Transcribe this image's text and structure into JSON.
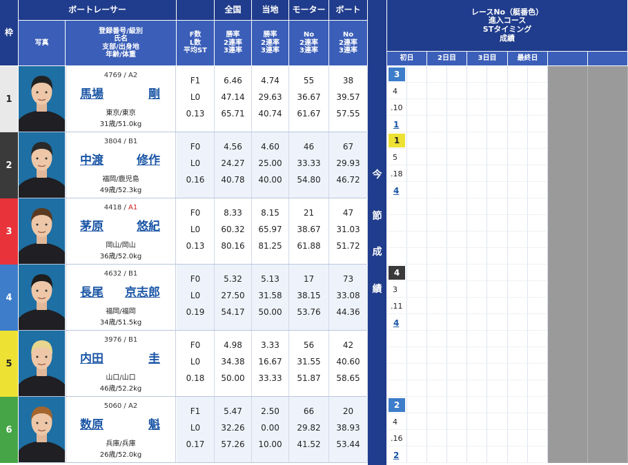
{
  "header": {
    "waku": "枠",
    "boat_racer": "ボートレーサー",
    "zenkoku": "全国",
    "touchi": "当地",
    "motor": "モーター",
    "boat": "ボート",
    "photo": "写真",
    "racer_sub": [
      "登録番号/級別",
      "氏名",
      "支部/出身地",
      "年齢/体重"
    ],
    "f_sub": [
      "F数",
      "L数",
      "平均ST"
    ],
    "rate_sub": [
      "勝率",
      "2連率",
      "3連率"
    ],
    "no_sub": [
      "No",
      "2連率",
      "3連率"
    ],
    "results_title": [
      "レースNo（艇番色）",
      "進入コース",
      "STタイミング",
      "成績"
    ],
    "days": [
      "初日",
      "2日目",
      "3日目",
      "最終日"
    ],
    "konsetsu": [
      "今",
      "節",
      "成",
      "績"
    ]
  },
  "colors": {
    "header_dark": "#203c8c",
    "header_light": "#3b5eb8",
    "waku": [
      "#ffffff",
      "#3a3a3a",
      "#e8333a",
      "#3d7dca",
      "#ede134",
      "#46a546"
    ],
    "waku_text": [
      "#222222",
      "#ffffff",
      "#ffffff",
      "#ffffff",
      "#222222",
      "#ffffff"
    ]
  },
  "racers": [
    {
      "waku": "1",
      "reg": "4769 / A2",
      "class_highlight": false,
      "name_a": "馬場",
      "name_b": "剛",
      "branch": "東京/東京",
      "age": "31歳/51.0kg",
      "f": "F1",
      "l": "L0",
      "st": "0.13",
      "zen": [
        "6.46",
        "47.14",
        "65.71"
      ],
      "tou": [
        "4.74",
        "29.63",
        "40.74"
      ],
      "motor": [
        "55",
        "36.67",
        "61.67"
      ],
      "boat": [
        "38",
        "39.57",
        "57.55"
      ],
      "results": [
        {
          "race": "3",
          "course": "4",
          "st": ".10",
          "rank": "1"
        }
      ]
    },
    {
      "waku": "2",
      "reg": "3804 / B1",
      "class_highlight": false,
      "name_a": "中渡",
      "name_b": "修作",
      "branch": "福岡/鹿児島",
      "age": "49歳/52.3kg",
      "f": "F0",
      "l": "L0",
      "st": "0.16",
      "zen": [
        "4.56",
        "24.27",
        "40.78"
      ],
      "tou": [
        "4.60",
        "25.00",
        "40.00"
      ],
      "motor": [
        "46",
        "33.33",
        "54.80"
      ],
      "boat": [
        "67",
        "29.93",
        "46.72"
      ],
      "results": [
        {
          "race": "1",
          "course": "5",
          "st": ".18",
          "rank": "4"
        }
      ]
    },
    {
      "waku": "3",
      "reg_num": "4418 / ",
      "reg_cls": "A1",
      "class_highlight": true,
      "name_a": "茅原",
      "name_b": "悠紀",
      "branch": "岡山/岡山",
      "age": "36歳/52.0kg",
      "f": "F0",
      "l": "L0",
      "st": "0.13",
      "zen": [
        "8.33",
        "60.32",
        "80.16"
      ],
      "tou": [
        "8.15",
        "65.97",
        "81.25"
      ],
      "motor": [
        "21",
        "38.67",
        "61.88"
      ],
      "boat": [
        "47",
        "31.03",
        "51.72"
      ],
      "results": []
    },
    {
      "waku": "4",
      "reg": "4632 / B1",
      "class_highlight": false,
      "name_a": "長尾",
      "name_b": "京志郎",
      "branch": "福岡/福岡",
      "age": "34歳/51.5kg",
      "f": "F0",
      "l": "L0",
      "st": "0.19",
      "zen": [
        "5.32",
        "27.50",
        "54.17"
      ],
      "tou": [
        "5.13",
        "31.58",
        "50.00"
      ],
      "motor": [
        "17",
        "38.15",
        "53.76"
      ],
      "boat": [
        "73",
        "33.08",
        "44.36"
      ],
      "results": [
        {
          "race": "4",
          "course": "3",
          "st": ".11",
          "rank": "4"
        }
      ]
    },
    {
      "waku": "5",
      "reg": "3976 / B1",
      "class_highlight": false,
      "name_a": "内田",
      "name_b": "圭",
      "branch": "山口/山口",
      "age": "46歳/52.2kg",
      "f": "F0",
      "l": "L0",
      "st": "0.18",
      "zen": [
        "4.98",
        "34.38",
        "50.00"
      ],
      "tou": [
        "3.33",
        "16.67",
        "33.33"
      ],
      "motor": [
        "56",
        "31.55",
        "51.87"
      ],
      "boat": [
        "42",
        "40.60",
        "58.65"
      ],
      "results": []
    },
    {
      "waku": "6",
      "reg": "5060 / A2",
      "class_highlight": false,
      "name_a": "数原",
      "name_b": "魁",
      "branch": "兵庫/兵庫",
      "age": "26歳/52.0kg",
      "f": "F1",
      "l": "L0",
      "st": "0.17",
      "zen": [
        "5.47",
        "32.26",
        "57.26"
      ],
      "tou": [
        "2.50",
        "0.00",
        "10.00"
      ],
      "motor": [
        "66",
        "29.82",
        "41.52"
      ],
      "boat": [
        "20",
        "38.93",
        "53.44"
      ],
      "results": [
        {
          "race": "2",
          "course": "4",
          "st": ".16",
          "rank": "2"
        }
      ]
    }
  ]
}
